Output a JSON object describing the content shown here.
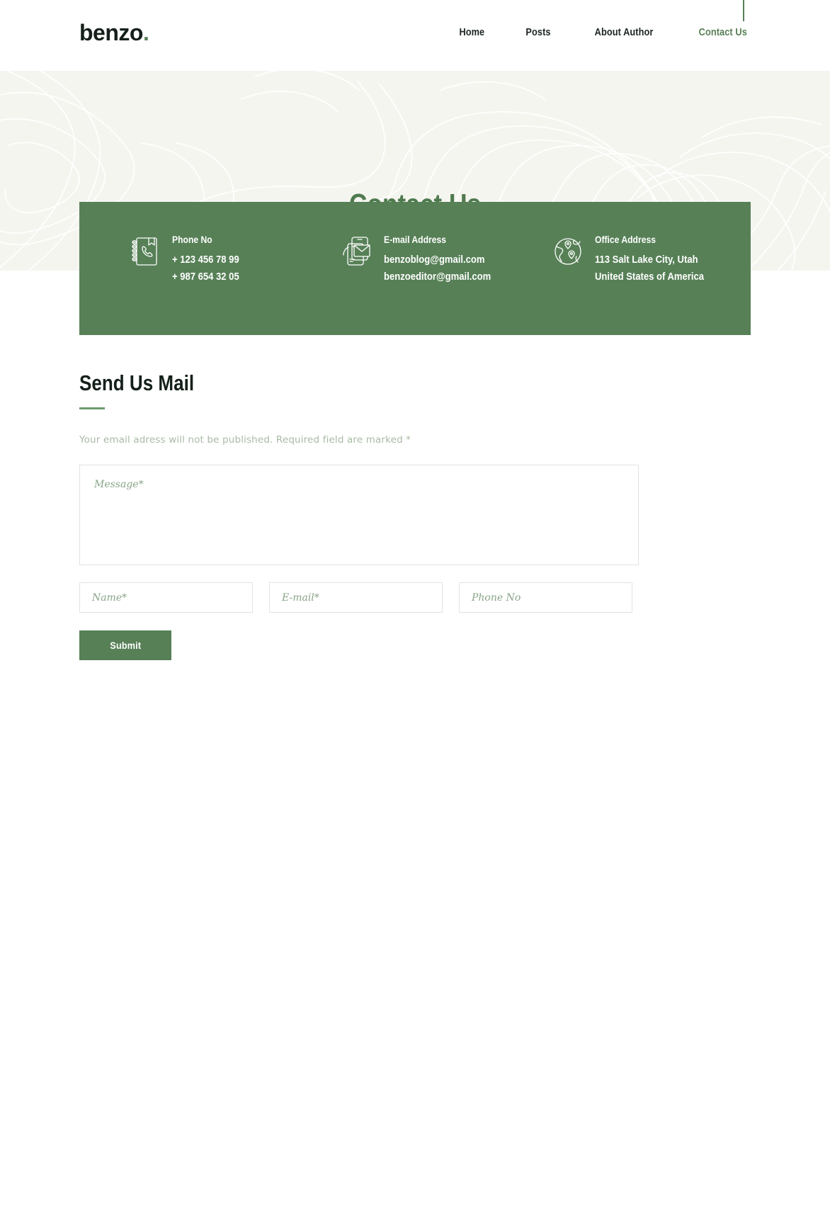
{
  "brand": {
    "name": "benzo",
    "dot": "."
  },
  "nav": {
    "items": [
      {
        "label": "Home",
        "active": false
      },
      {
        "label": "Posts",
        "active": false
      },
      {
        "label": "About Author",
        "active": false
      },
      {
        "label": "Contact Us",
        "active": true
      }
    ]
  },
  "hero": {
    "title": "Contact Us"
  },
  "contact_card": {
    "background": "#578057",
    "blocks": [
      {
        "icon": "phone-book-icon",
        "label": "Phone No",
        "values": [
          "+ 123 456 78 99",
          "+ 987 654 32 05"
        ]
      },
      {
        "icon": "email-mobile-icon",
        "label": "E-mail Address",
        "values": [
          "benzoblog@gmail.com",
          "benzoeditor@gmail.com"
        ]
      },
      {
        "icon": "globe-location-icon",
        "label": "Office Address",
        "values": [
          "113 Salt Lake City, Utah",
          "United States of America"
        ]
      }
    ]
  },
  "form": {
    "title": "Send Us Mail",
    "note": "Your email adress will not be published. Required field are marked *",
    "message": {
      "placeholder": "Message*",
      "value": ""
    },
    "name": {
      "placeholder": "Name*",
      "value": ""
    },
    "email": {
      "placeholder": "E-mail*",
      "value": ""
    },
    "phone": {
      "placeholder": "Phone No",
      "value": ""
    },
    "submit_label": "Submit"
  },
  "theme": {
    "accent": "#578057",
    "hero_bg": "#f5f5f0",
    "text_dark": "#15201a",
    "note_color": "#a9bba6",
    "placeholder_color": "#8aa588"
  }
}
